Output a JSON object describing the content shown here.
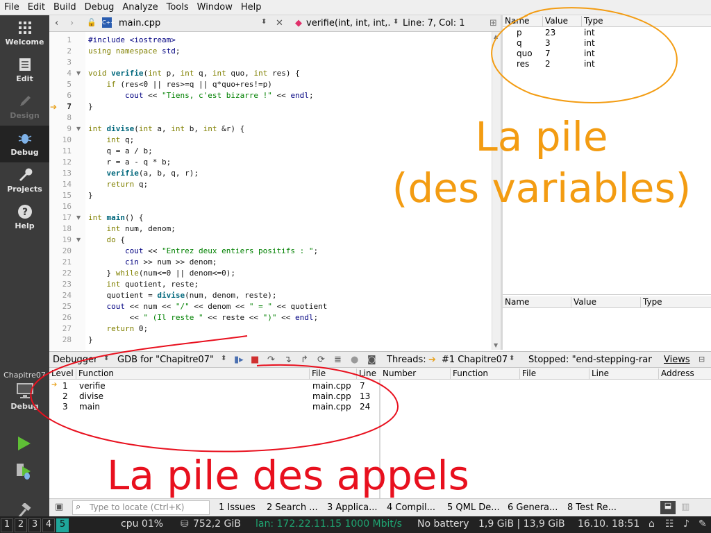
{
  "menu": [
    "File",
    "Edit",
    "Build",
    "Debug",
    "Analyze",
    "Tools",
    "Window",
    "Help"
  ],
  "modes": [
    {
      "label": "Welcome",
      "icon": "grid-icon"
    },
    {
      "label": "Edit",
      "icon": "document-icon"
    },
    {
      "label": "Design",
      "icon": "pen-icon"
    },
    {
      "label": "Debug",
      "icon": "bug-icon"
    },
    {
      "label": "Projects",
      "icon": "wrench-icon"
    },
    {
      "label": "Help",
      "icon": "question-icon"
    }
  ],
  "editor_toolbar": {
    "filename": "main.cpp",
    "function": "verifie(int, int, int,...",
    "position": "Line: 7, Col: 1"
  },
  "code_lines": [
    "#include <iostream>",
    "using namespace std;",
    "",
    "void verifie(int p, int q, int quo, int res) {",
    "    if (res<0 || res>=q || q*quo+res!=p)",
    "        cout << \"Tiens, c'est bizarre !\" << endl;",
    "}",
    "",
    "int divise(int a, int b, int &r) {",
    "    int q;",
    "    q = a / b;",
    "    r = a - q * b;",
    "    verifie(a, b, q, r);",
    "    return q;",
    "}",
    "",
    "int main() {",
    "    int num, denom;",
    "    do {",
    "        cout << \"Entrez deux entiers positifs : \";",
    "        cin >> num >> denom;",
    "    } while(num<=0 || denom<=0);",
    "    int quotient, reste;",
    "    quotient = divise(num, denom, reste);",
    "    cout << num << \"/\" << denom << \" = \" << quotient",
    "         << \" (Il reste \" << reste << \")\" << endl;",
    "    return 0;",
    "}"
  ],
  "locals": {
    "headers": [
      "Name",
      "Value",
      "Type"
    ],
    "rows": [
      {
        "name": "p",
        "value": "23",
        "type": "int"
      },
      {
        "name": "q",
        "value": "3",
        "type": "int"
      },
      {
        "name": "quo",
        "value": "7",
        "type": "int"
      },
      {
        "name": "res",
        "value": "2",
        "type": "int"
      }
    ]
  },
  "expressions": {
    "headers": [
      "Name",
      "Value",
      "Type"
    ]
  },
  "annotation_vars": {
    "line1": "La pile",
    "line2": "(des variables)"
  },
  "annotation_calls": "La pile des appels",
  "debugger_toolbar": {
    "debugger": "Debugger",
    "engine": "GDB for \"Chapitre07\"",
    "threads_label": "Threads:",
    "thread": "#1 Chapitre07",
    "stopped": "Stopped: \"end-stepping-range\"",
    "views": "Views"
  },
  "stack": {
    "headers": [
      "Level",
      "Function",
      "File",
      "Line"
    ],
    "rows": [
      {
        "level": "1",
        "function": "verifie",
        "file": "main.cpp",
        "line": "7"
      },
      {
        "level": "2",
        "function": "divise",
        "file": "main.cpp",
        "line": "13"
      },
      {
        "level": "3",
        "function": "main",
        "file": "main.cpp",
        "line": "24"
      }
    ]
  },
  "breakpoints": {
    "headers": [
      "Number",
      "Function",
      "File",
      "Line",
      "Address"
    ]
  },
  "kit": {
    "project": "Chapitre07",
    "config": "Debug"
  },
  "locator_placeholder": "Type to locate (Ctrl+K)",
  "output_tabs": [
    "1  Issues",
    "2  Search ...",
    "3  Applica...",
    "4  Compil...",
    "5  QML De...",
    "6  Genera...",
    "8  Test Re..."
  ],
  "taskbar": {
    "workspaces": [
      "1",
      "2",
      "3",
      "4",
      "5"
    ],
    "cpu": "cpu   01%",
    "disk": "752,2 GiB",
    "lan": "lan: 172.22.11.15 1000 Mbit/s",
    "battery": "No battery",
    "mem": "1,9 GiB | 13,9 GiB",
    "clock": "16.10. 18:51"
  },
  "colors": {
    "annotation_orange": "#f39c12",
    "annotation_red": "#e8101e",
    "lan_green": "#1fa672"
  }
}
